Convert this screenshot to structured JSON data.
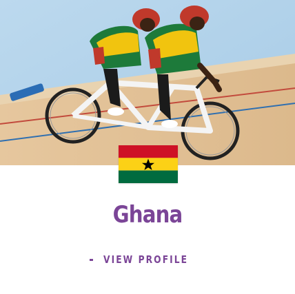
{
  "country_card": {
    "name": "Ghana",
    "link_label": "VIEW PROFILE",
    "flag_icon": "ghana-flag-icon",
    "photo": "tandem-cyclists-velodrome"
  },
  "colors": {
    "accent": "#7b4597",
    "flag_red": "#ce1126",
    "flag_gold": "#fcd116",
    "flag_green": "#006b3f",
    "flag_star": "#000000",
    "background": "#ffffff"
  }
}
